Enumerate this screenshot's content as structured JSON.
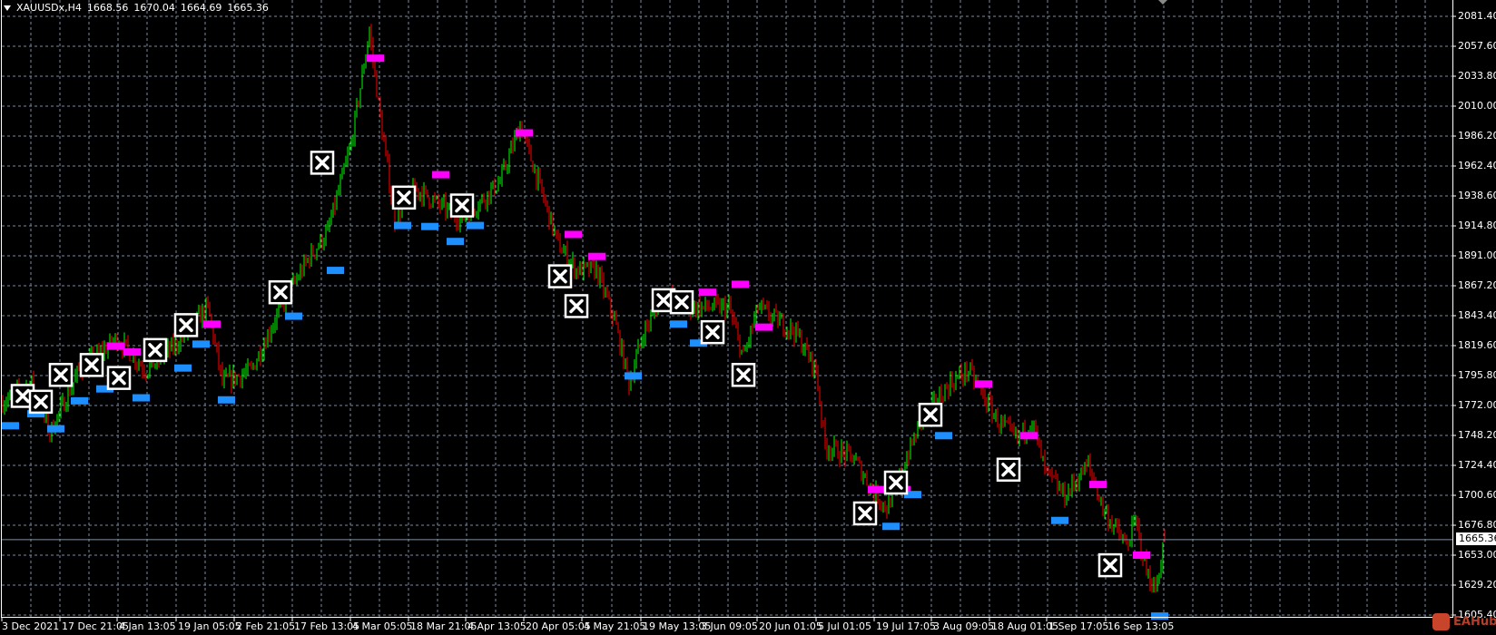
{
  "header": {
    "symbol": "XAUUSDx,H4",
    "open": "1668.56",
    "high": "1670.04",
    "low": "1664.69",
    "close": "1665.36"
  },
  "price_axis": [
    "2081.40",
    "2057.60",
    "2033.80",
    "2010.00",
    "1986.20",
    "1962.40",
    "1938.60",
    "1914.80",
    "1891.00",
    "1867.20",
    "1843.40",
    "1819.60",
    "1795.80",
    "1772.00",
    "1748.20",
    "1724.40",
    "1700.60",
    "1676.80",
    "1653.00",
    "1629.20",
    "1605.40"
  ],
  "current_price": "1665.36",
  "time_axis": [
    "3 Dec 2021",
    "17 Dec 21:05",
    "4 Jan 13:05",
    "19 Jan 05:05",
    "2 Feb 21:05",
    "17 Feb 13:05",
    "4 Mar 05:05",
    "18 Mar 21:05",
    "4 Apr 13:05",
    "20 Apr 05:05",
    "4 May 21:05",
    "19 May 13:05",
    "3 Jun 09:05",
    "20 Jun 01:05",
    "5 Jul 01:05",
    "19 Jul 17:05",
    "3 Aug 09:05",
    "18 Aug 01:05",
    "1 Sep 17:05",
    "16 Sep 13:05"
  ],
  "watermark": "EAHub",
  "colors": {
    "up": "#00ff00",
    "down": "#ff0000",
    "grid": "#7d8a9c",
    "sell_marker": "#ff00ff",
    "buy_marker": "#1e8fff"
  },
  "chart_data": {
    "type": "candlestick",
    "symbol": "XAUUSDx",
    "timeframe": "H4",
    "ylim": [
      1605.4,
      2081.4
    ],
    "price_waypoints": [
      [
        0,
        1775
      ],
      [
        16,
        1790
      ],
      [
        26,
        1750
      ],
      [
        42,
        1800
      ],
      [
        63,
        1825
      ],
      [
        79,
        1800
      ],
      [
        95,
        1820
      ],
      [
        113,
        1850
      ],
      [
        121,
        1790
      ],
      [
        137,
        1800
      ],
      [
        153,
        1850
      ],
      [
        169,
        1890
      ],
      [
        179,
        1910
      ],
      [
        192,
        1980
      ],
      [
        202,
        2070
      ],
      [
        208,
        2000
      ],
      [
        216,
        1920
      ],
      [
        227,
        1945
      ],
      [
        242,
        1930
      ],
      [
        253,
        1920
      ],
      [
        274,
        1950
      ],
      [
        285,
        1995
      ],
      [
        295,
        1950
      ],
      [
        306,
        1900
      ],
      [
        316,
        1880
      ],
      [
        327,
        1880
      ],
      [
        337,
        1840
      ],
      [
        345,
        1790
      ],
      [
        353,
        1830
      ],
      [
        364,
        1860
      ],
      [
        379,
        1850
      ],
      [
        400,
        1850
      ],
      [
        408,
        1810
      ],
      [
        416,
        1850
      ],
      [
        437,
        1830
      ],
      [
        448,
        1800
      ],
      [
        453,
        1740
      ],
      [
        469,
        1730
      ],
      [
        477,
        1710
      ],
      [
        487,
        1690
      ],
      [
        495,
        1720
      ],
      [
        506,
        1760
      ],
      [
        522,
        1790
      ],
      [
        532,
        1800
      ],
      [
        548,
        1760
      ],
      [
        559,
        1745
      ],
      [
        567,
        1760
      ],
      [
        574,
        1720
      ],
      [
        585,
        1700
      ],
      [
        598,
        1725
      ],
      [
        606,
        1690
      ],
      [
        619,
        1660
      ],
      [
        624,
        1680
      ],
      [
        630,
        1640
      ],
      [
        635,
        1625
      ],
      [
        640,
        1665.36
      ]
    ],
    "close_markers": [
      [
        11,
        1779.6
      ],
      [
        21,
        1775
      ],
      [
        32,
        1796.3
      ],
      [
        49,
        1804.2
      ],
      [
        64,
        1793.9
      ],
      [
        84,
        1816.1
      ],
      [
        101,
        1835.9
      ],
      [
        153,
        1862
      ],
      [
        176,
        1965
      ],
      [
        221,
        1937.3
      ],
      [
        253,
        1931
      ],
      [
        307,
        1874.7
      ],
      [
        316,
        1851
      ],
      [
        364,
        1855.7
      ],
      [
        374,
        1854.1
      ],
      [
        391,
        1830.3
      ],
      [
        408,
        1796.3
      ],
      [
        475,
        1686.2
      ],
      [
        492,
        1710.7
      ],
      [
        511,
        1764.6
      ],
      [
        554,
        1721
      ],
      [
        610,
        1645
      ]
    ],
    "sell_levels": [
      [
        62,
        1819.2
      ],
      [
        71,
        1814.5
      ],
      [
        115,
        1836.7
      ],
      [
        205,
        2048.1
      ],
      [
        241,
        1955.5
      ],
      [
        287,
        1988.7
      ],
      [
        314,
        1908
      ],
      [
        327,
        1890.5
      ],
      [
        388,
        1862
      ],
      [
        406,
        1868.4
      ],
      [
        419,
        1834.3
      ],
      [
        481,
        1705.2
      ],
      [
        495,
        1705.2
      ],
      [
        540,
        1789.1
      ],
      [
        565,
        1748
      ],
      [
        603,
        1709.2
      ],
      [
        627,
        1653
      ]
    ],
    "buy_levels": [
      [
        4,
        1755.9
      ],
      [
        18,
        1765.4
      ],
      [
        29,
        1753.5
      ],
      [
        42,
        1775.7
      ],
      [
        56,
        1785.2
      ],
      [
        76,
        1778.1
      ],
      [
        99,
        1801.8
      ],
      [
        109,
        1820.8
      ],
      [
        123,
        1776.5
      ],
      [
        160,
        1843
      ],
      [
        183,
        1879.4
      ],
      [
        220,
        1915.1
      ],
      [
        235,
        1914.3
      ],
      [
        249,
        1902.4
      ],
      [
        260,
        1915.1
      ],
      [
        347,
        1795.5
      ],
      [
        372,
        1836.7
      ],
      [
        383,
        1821.6
      ],
      [
        489,
        1675.9
      ],
      [
        501,
        1701.2
      ],
      [
        518,
        1748
      ],
      [
        582,
        1680.6
      ],
      [
        637,
        1604.6
      ]
    ]
  }
}
